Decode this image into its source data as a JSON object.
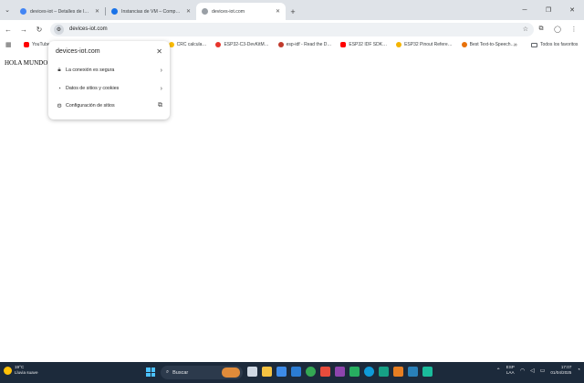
{
  "browser": {
    "tabs": [
      {
        "title": "devices-iot – Detalles de la sol…",
        "favicon_color": "#4285f4",
        "active": false
      },
      {
        "title": "Instancias de VM – Compute E…",
        "favicon_color": "#1a73e8",
        "active": false
      },
      {
        "title": "devices-iot.com",
        "favicon_color": "#9aa0a6",
        "active": true
      }
    ],
    "new_tab_icon": "plus-icon",
    "url": "devices-iot.com",
    "bookmarks": [
      {
        "label": "YouTube",
        "color": "#ff0000"
      },
      {
        "label": "CRC calcula…",
        "color": "#fbbc04"
      },
      {
        "label": "ESP32-C3-DevKitM…",
        "color": "#e7352c"
      },
      {
        "label": "esp-idf - Read the D…",
        "color": "#c0392b"
      },
      {
        "label": "ESP32 IDF SDK…",
        "color": "#ff0000"
      },
      {
        "label": "ESP32 Pinout Refere…",
        "color": "#f4b400"
      },
      {
        "label": "Best Text-to-Speech…",
        "color": "#e8710a"
      }
    ],
    "all_bookmarks_label": "Todos los favoritos"
  },
  "page": {
    "body_text": "HOLA MUNDO"
  },
  "site_info": {
    "domain": "devices-iot.com",
    "items": [
      {
        "label": "La conexión es segura",
        "icon": "lock-icon"
      },
      {
        "label": "Datos de sitios y cookies",
        "icon": "cookie-icon"
      },
      {
        "label": "Configuración de sitios",
        "icon": "gear-icon"
      }
    ]
  },
  "taskbar": {
    "weather_temp": "19°C",
    "weather_desc": "Lluvia suave",
    "search_label": "Buscar",
    "lang_line1": "ESP",
    "lang_line2": "LAA",
    "time": "17:07",
    "date": "01/04/2025"
  }
}
